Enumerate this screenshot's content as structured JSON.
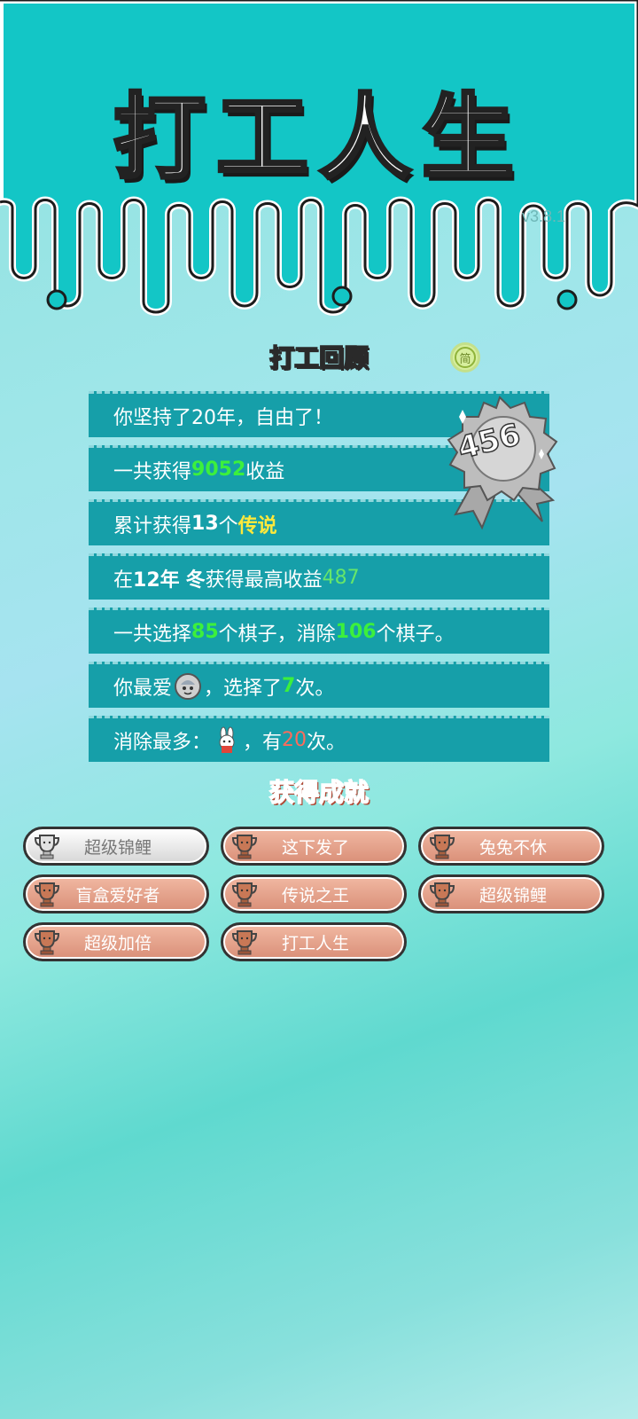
{
  "app": {
    "title": "打工人生",
    "version": "v3.8.1"
  },
  "colors": {
    "accent_teal": "#13c6c6",
    "row_bg": "#169fa9",
    "green": "#3cf03c",
    "yellow": "#ffe93b",
    "red": "#ff6b5b",
    "ach_bronze": "#d98f78"
  },
  "review": {
    "title": "打工回顾",
    "simplified_button": "简",
    "badge_number": "456",
    "rows": {
      "r1": {
        "text": "你坚持了20年，自由了！"
      },
      "r2": {
        "pre": "一共获得",
        "value": "9052",
        "post": "收益"
      },
      "r3": {
        "pre": "累计获得",
        "count": "13",
        "mid": "个",
        "tag": "传说"
      },
      "r4": {
        "pre": "在 ",
        "year": "12年",
        "season": "冬",
        "mid": " 获得最高收益",
        "value": "487"
      },
      "r5": {
        "pre": "一共选择",
        "picked": "85",
        "mid": "个棋子，消除",
        "removed": "106",
        "post": "个棋子。"
      },
      "r6": {
        "pre": "你最爱",
        "mid": "，选择了",
        "times": "7",
        "post": "次。"
      },
      "r7": {
        "pre": "消除最多：",
        "mid": "，有",
        "times": "20",
        "post": "次。"
      }
    }
  },
  "achievements": {
    "title": "获得成就",
    "items": [
      {
        "label": "超级锦鲤",
        "tier": "silver"
      },
      {
        "label": "这下发了",
        "tier": "bronze"
      },
      {
        "label": "兔兔不休",
        "tier": "bronze"
      },
      {
        "label": "盲盒爱好者",
        "tier": "bronze"
      },
      {
        "label": "传说之王",
        "tier": "bronze"
      },
      {
        "label": "超级锦鲤",
        "tier": "bronze"
      },
      {
        "label": "超级加倍",
        "tier": "bronze"
      },
      {
        "label": "打工人生",
        "tier": "bronze"
      }
    ]
  }
}
